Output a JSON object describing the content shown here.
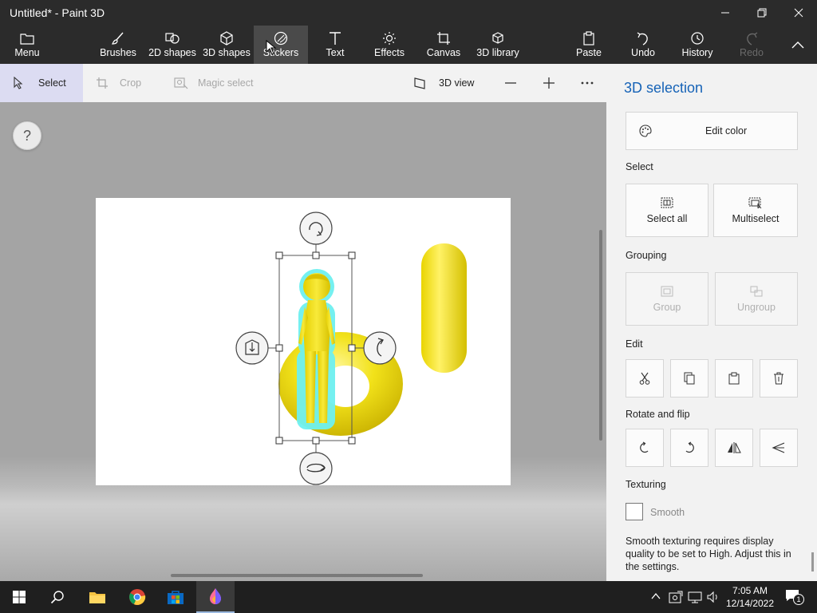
{
  "window": {
    "title": "Untitled* - Paint 3D"
  },
  "ribbon": {
    "menu": "Menu",
    "items": [
      {
        "label": "Brushes"
      },
      {
        "label": "2D shapes"
      },
      {
        "label": "3D shapes"
      },
      {
        "label": "Stickers"
      },
      {
        "label": "Text"
      },
      {
        "label": "Effects"
      },
      {
        "label": "Canvas"
      },
      {
        "label": "3D library"
      }
    ],
    "actions": [
      {
        "label": "Paste"
      },
      {
        "label": "Undo"
      },
      {
        "label": "History"
      },
      {
        "label": "Redo"
      }
    ]
  },
  "toolbar": {
    "select": "Select",
    "crop": "Crop",
    "magic_select": "Magic select",
    "view_3d": "3D view"
  },
  "workspace": {
    "help": "?"
  },
  "panel": {
    "title": "3D selection",
    "edit_color": "Edit color",
    "select_heading": "Select",
    "select_all": "Select all",
    "multiselect": "Multiselect",
    "grouping_heading": "Grouping",
    "group": "Group",
    "ungroup": "Ungroup",
    "edit_heading": "Edit",
    "rotate_heading": "Rotate and flip",
    "texturing_heading": "Texturing",
    "smooth": "Smooth",
    "smooth_checked": false,
    "note": "Smooth texturing requires display quality to be set to High. Adjust this in the settings."
  },
  "taskbar": {
    "time": "7:05 AM",
    "date": "12/14/2022",
    "notifications": "1"
  },
  "colors": {
    "accent": "#1663b7",
    "chrome": "#2b2b2b",
    "selection_glow": "#6ef0f0",
    "shape_yellow": "#f2e21a"
  }
}
